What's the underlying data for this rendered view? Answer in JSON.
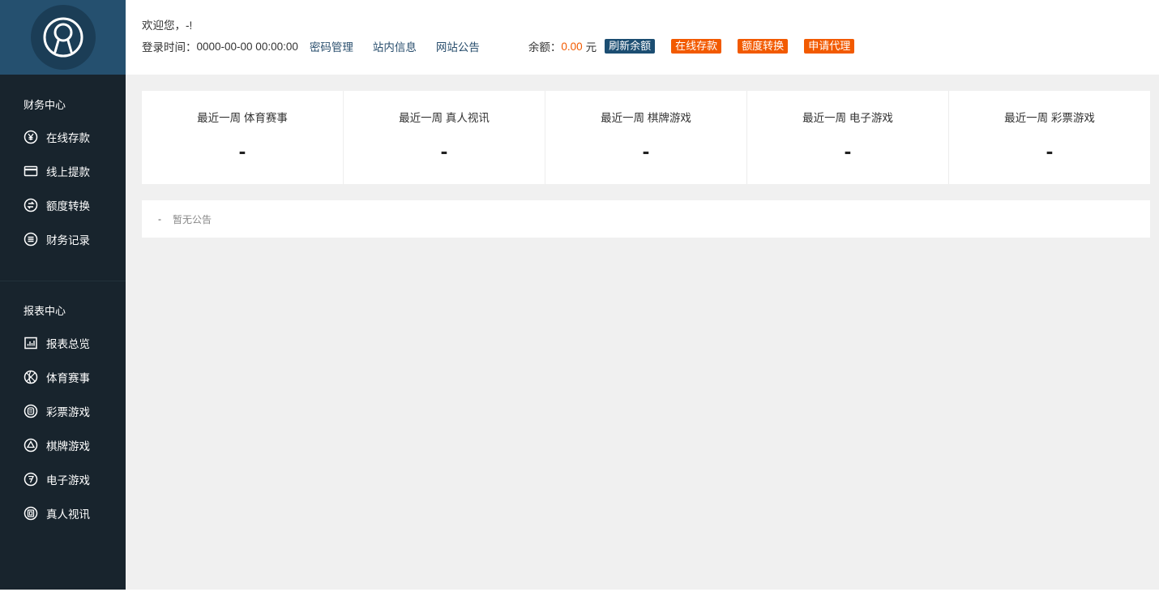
{
  "header": {
    "welcome": "欢迎您，-!",
    "login_time_label": "登录时间：",
    "login_time": "0000-00-00 00:00:00",
    "links": [
      "密码管理",
      "站内信息",
      "网站公告"
    ],
    "balance_label": "余额：",
    "balance_value": "0.00",
    "balance_unit": "元",
    "buttons": {
      "refresh": "刷新余额",
      "deposit": "在线存款",
      "transfer": "额度转换",
      "agent": "申请代理"
    }
  },
  "sidebar": {
    "finance_title": "财务中心",
    "finance_items": [
      {
        "label": "在线存款",
        "icon": "yen-icon"
      },
      {
        "label": "线上提款",
        "icon": "card-icon"
      },
      {
        "label": "额度转换",
        "icon": "exchange-icon"
      },
      {
        "label": "财务记录",
        "icon": "list-icon"
      }
    ],
    "report_title": "报表中心",
    "report_items": [
      {
        "label": "报表总览",
        "icon": "chart-icon"
      },
      {
        "label": "体育赛事",
        "icon": "ball-icon"
      },
      {
        "label": "彩票游戏",
        "icon": "lottery-icon"
      },
      {
        "label": "棋牌游戏",
        "icon": "poker-icon"
      },
      {
        "label": "电子游戏",
        "icon": "slot-icon"
      },
      {
        "label": "真人视讯",
        "icon": "live-icon"
      }
    ]
  },
  "stats": [
    {
      "title": "最近一周 体育赛事",
      "value": "-"
    },
    {
      "title": "最近一周 真人视讯",
      "value": "-"
    },
    {
      "title": "最近一周 棋牌游戏",
      "value": "-"
    },
    {
      "title": "最近一周 电子游戏",
      "value": "-"
    },
    {
      "title": "最近一周 彩票游戏",
      "value": "-"
    }
  ],
  "notice": {
    "bullet": "-",
    "text": "暂无公告"
  },
  "colors": {
    "sidebar_bg": "#18242d",
    "logo_bg": "#25506f",
    "accent_blue": "#1c4e72",
    "accent_orange": "#f25a00"
  }
}
